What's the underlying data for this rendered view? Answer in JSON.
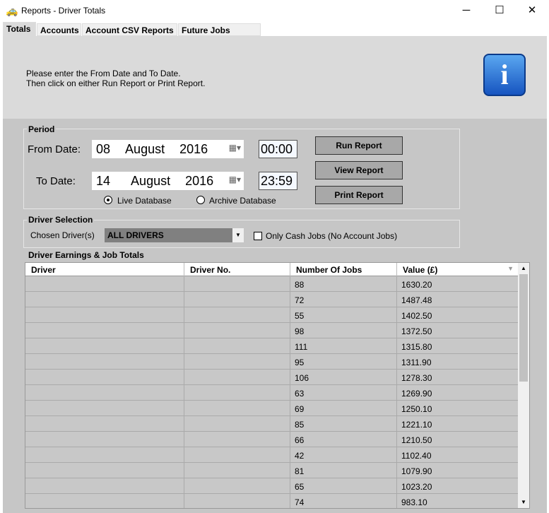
{
  "window": {
    "title": "Reports - Driver Totals",
    "minimize": "─",
    "maximize": "☐",
    "close": "✕"
  },
  "tabs": [
    {
      "label": "Totals",
      "active": true
    },
    {
      "label": "Accounts"
    },
    {
      "label": "Account CSV Reports"
    },
    {
      "label": "Future Jobs Report"
    }
  ],
  "message": {
    "line1": "Please enter the From Date and To Date.",
    "line2": "Then click on either Run Report or Print Report."
  },
  "info_icon": "i",
  "period": {
    "legend": "Period",
    "from_label": "From Date:",
    "from_day": "08",
    "from_month": "August",
    "from_year": "2016",
    "from_time": "00:00",
    "to_label": "To  Date:",
    "to_day": "14",
    "to_month": "August",
    "to_year": "2016",
    "to_time": "23:59",
    "live_label": "Live Database",
    "archive_label": "Archive Database",
    "selected_db": "live"
  },
  "buttons": {
    "run": "Run Report",
    "view": "View Report",
    "print": "Print Report"
  },
  "driver_selection": {
    "legend": "Driver Selection",
    "chosen_label": "Chosen Driver(s)",
    "chosen_value": "ALL DRIVERS",
    "cash_only_label": "Only Cash Jobs (No Account Jobs)",
    "cash_only_checked": false
  },
  "totals": {
    "legend": "Driver Earnings & Job Totals",
    "columns": [
      "Driver",
      "Driver No.",
      "Number Of Jobs",
      "Value (£)"
    ],
    "rows": [
      [
        "",
        "",
        "88",
        "1630.20"
      ],
      [
        "",
        "",
        "72",
        "1487.48"
      ],
      [
        "",
        "",
        "55",
        "1402.50"
      ],
      [
        "",
        "",
        "98",
        "1372.50"
      ],
      [
        "",
        "",
        "111",
        "1315.80"
      ],
      [
        "",
        "",
        "95",
        "1311.90"
      ],
      [
        "",
        "",
        "106",
        "1278.30"
      ],
      [
        "",
        "",
        "63",
        "1269.90"
      ],
      [
        "",
        "",
        "69",
        "1250.10"
      ],
      [
        "",
        "",
        "85",
        "1221.10"
      ],
      [
        "",
        "",
        "66",
        "1210.50"
      ],
      [
        "",
        "",
        "42",
        "1102.40"
      ],
      [
        "",
        "",
        "81",
        "1079.90"
      ],
      [
        "",
        "",
        "65",
        "1023.20"
      ],
      [
        "",
        "",
        "74",
        "983.10"
      ]
    ]
  }
}
